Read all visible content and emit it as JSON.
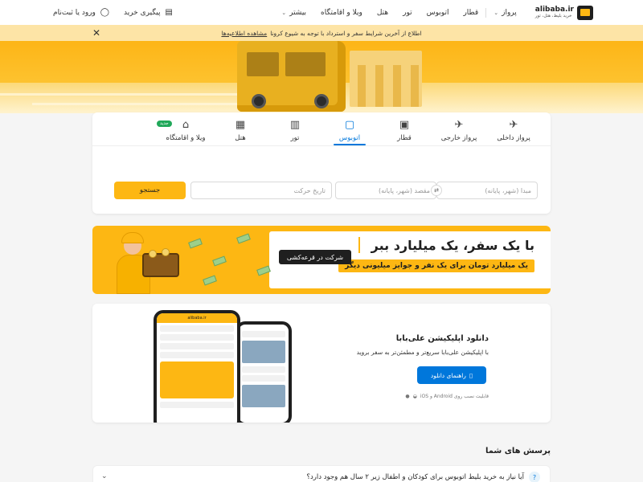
{
  "header": {
    "brand": "alibaba.ir",
    "brand_tagline": "خرید بلیط، هتل، تور",
    "nav": [
      {
        "label": "پرواز",
        "has_dropdown": true
      },
      {
        "label": "قطار",
        "has_dropdown": false
      },
      {
        "label": "اتوبوس",
        "has_dropdown": false
      },
      {
        "label": "تور",
        "has_dropdown": false
      },
      {
        "label": "هتل",
        "has_dropdown": false
      },
      {
        "label": "ویلا و اقامتگاه",
        "has_dropdown": false
      },
      {
        "label": "بیشتر",
        "has_dropdown": true
      }
    ],
    "track_order": "پیگیری خرید",
    "login": "ورود یا ثبت‌نام"
  },
  "notice": {
    "text": "اطلاع از آخرین شرایط سفر و استرداد با توجه به شیوع کرونا",
    "link": "مشاهده اطلاعیه‌ها"
  },
  "search": {
    "tabs": [
      {
        "label": "پرواز داخلی",
        "icon": "plane-icon",
        "active": false
      },
      {
        "label": "پرواز خارجی",
        "icon": "plane-international-icon",
        "active": false
      },
      {
        "label": "قطار",
        "icon": "train-icon",
        "active": false
      },
      {
        "label": "اتوبوس",
        "icon": "bus-icon",
        "active": true
      },
      {
        "label": "تور",
        "icon": "tour-icon",
        "active": false
      },
      {
        "label": "هتل",
        "icon": "hotel-icon",
        "active": false
      },
      {
        "label": "ویلا و اقامتگاه",
        "icon": "villa-icon",
        "active": false,
        "badge": "جدید"
      }
    ],
    "origin_placeholder": "مبدا (شهر، پایانه)",
    "destination_placeholder": "مقصد (شهر، پایانه)",
    "date_placeholder": "تاریخ حرکت",
    "button": "جستجو"
  },
  "promo": {
    "title": "با یک سفر، یک میلیارد ببر",
    "subtitle": "یک میلیارد تومان برای یک نفر و جوایز میلیونی دیگر",
    "cta": "شرکت در قرعه‌کشی"
  },
  "app": {
    "title": "دانلود اپلیکیشن علی‌بابا",
    "description": "با اپلیکیشن علی‌بابا سریع‌تر و مطمئن‌تر به سفر بروید",
    "button": "راهنمای دانلود",
    "note": "قابلیت نصب روی Android و iOS",
    "phone_brand": "alibaba.ir"
  },
  "faq": {
    "title": "پرسش های شما",
    "items": [
      "آیا نیاز به خرید بلیط اتوبوس برای کودکان و اطفال زیر ۲ سال هم وجود دارد؟"
    ]
  },
  "colors": {
    "brand_yellow": "#fdb713",
    "accent_blue": "#0077db",
    "notice_bg": "#fde4a6"
  }
}
